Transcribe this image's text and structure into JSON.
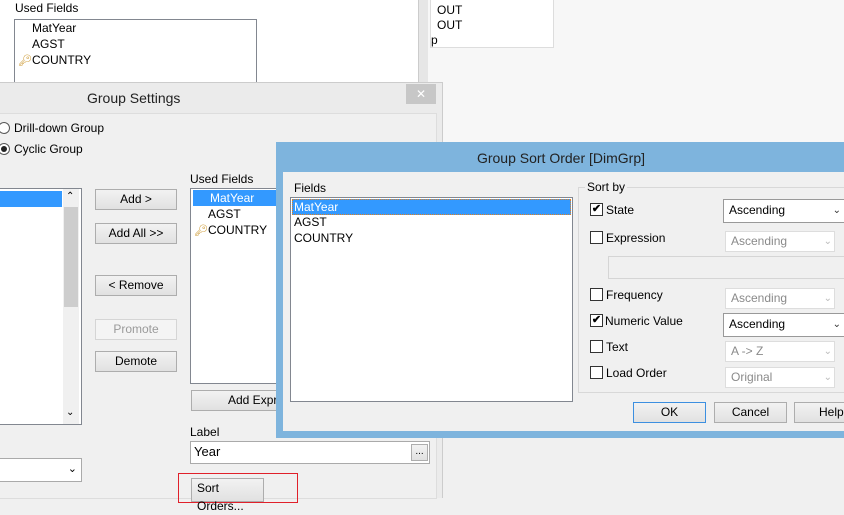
{
  "background": {
    "used_fields_label": "Used Fields",
    "used_fields": [
      "MatYear",
      "AGST",
      "COUNTRY"
    ],
    "right_panel_lines": [
      "OUT",
      "OUT",
      "p"
    ]
  },
  "group_settings": {
    "title": "Group Settings",
    "close_label": "✕",
    "radio_drilldown": "Drill-down Group",
    "radio_cyclic": "Cyclic Group",
    "buttons": {
      "add": "Add >",
      "add_all": "Add All >>",
      "remove": "< Remove",
      "promote": "Promote",
      "demote": "Demote",
      "add_expression": "Add Expre",
      "sort_orders": "Sort Orders...",
      "browse": "..."
    },
    "used_fields_label": "Used Fields",
    "used_fields": [
      "MatYear",
      "AGST",
      "COUNTRY"
    ],
    "label_caption": "Label",
    "label_value": "Year"
  },
  "sort_dialog": {
    "title": "Group Sort Order [DimGrp]",
    "fields_label": "Fields",
    "fields": [
      "MatYear",
      "AGST",
      "COUNTRY"
    ],
    "sort_by_label": "Sort by",
    "options": {
      "state": {
        "label": "State",
        "checked": true,
        "value": "Ascending"
      },
      "expression": {
        "label": "Expression",
        "checked": false,
        "value": "Ascending"
      },
      "frequency": {
        "label": "Frequency",
        "checked": false,
        "value": "Ascending"
      },
      "numeric": {
        "label": "Numeric Value",
        "checked": true,
        "value": "Ascending"
      },
      "text": {
        "label": "Text",
        "checked": false,
        "value": "A -> Z"
      },
      "load_order": {
        "label": "Load Order",
        "checked": false,
        "value": "Original"
      }
    },
    "ok": "OK",
    "cancel": "Cancel",
    "help": "Help"
  }
}
